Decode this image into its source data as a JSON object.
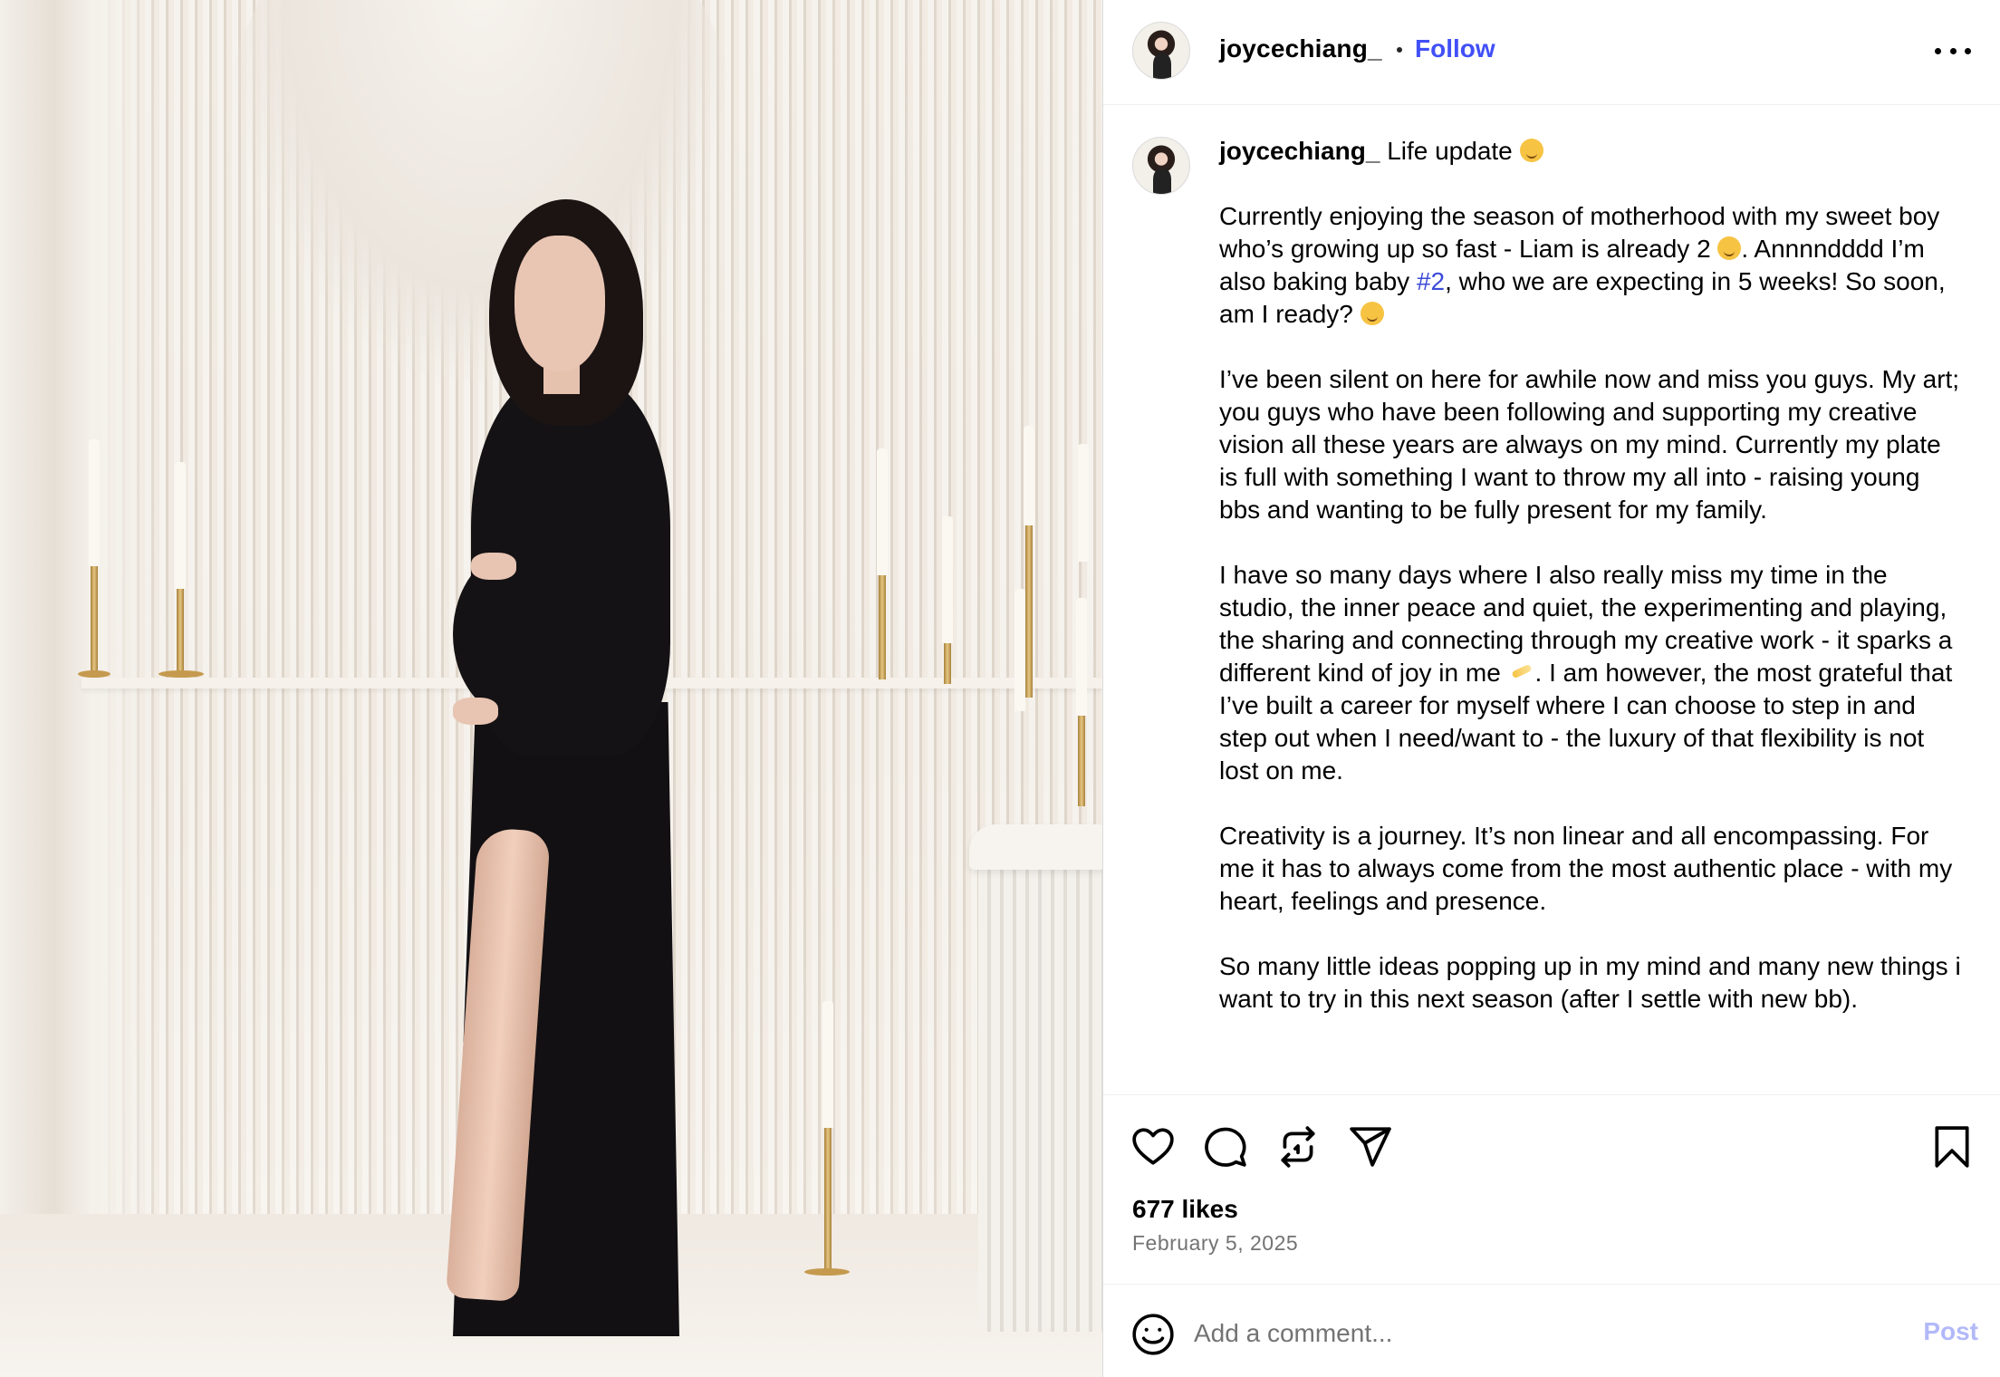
{
  "post": {
    "username": "joycechiang_",
    "follow_label": "Follow",
    "caption": {
      "username": "joycechiang_",
      "title": "Life update",
      "para1_a": "Currently enjoying the season of motherhood with my sweet boy who’s growing up so fast - Liam is already 2 ",
      "para1_b": ". Annnndddd I’m also baking baby ",
      "hashtag": "#2",
      "para1_c": ", who we are expecting in 5 weeks! So soon, am I ready? ",
      "para2": "I’ve been silent on here for awhile now and miss you guys. My art; you guys who have been following and supporting my creative vision all these years are always on my mind. Currently my plate is full with something I want to throw my all into - raising young bbs and wanting to be fully present for my family.",
      "para3_a": "I have so many days where I also really miss my time in the studio, the inner peace and quiet, the experimenting and playing, the sharing and connecting through my creative work - it sparks a different kind of joy in me ",
      "para3_b": ". I am however, the most grateful that I’ve built a career for myself where I can choose to step in and step out when I need/want to - the luxury of that flexibility is not lost on me.",
      "para4": "Creativity is a journey. It’s non linear and all encompassing. For me it has to always come from the most authentic place - with my heart, feelings and presence.",
      "para5": "So many little ideas popping up in my mind and many new things i want to try in this next season (after I settle with new bb)."
    },
    "likes": "677 likes",
    "date": "February 5, 2025",
    "comment": {
      "placeholder": "Add a comment...",
      "post_label": "Post"
    }
  },
  "icons": {
    "more": "more-options-icon",
    "like": "heart-icon",
    "comment": "comment-icon",
    "repost": "repost-icon",
    "share": "send-icon",
    "save": "bookmark-icon",
    "emoji": "emoji-icon"
  },
  "colors": {
    "follow": "#4150f7",
    "hashtag": "#3b4bd8",
    "post_disabled": "#b2b9f8",
    "secondary_text": "#737373"
  }
}
